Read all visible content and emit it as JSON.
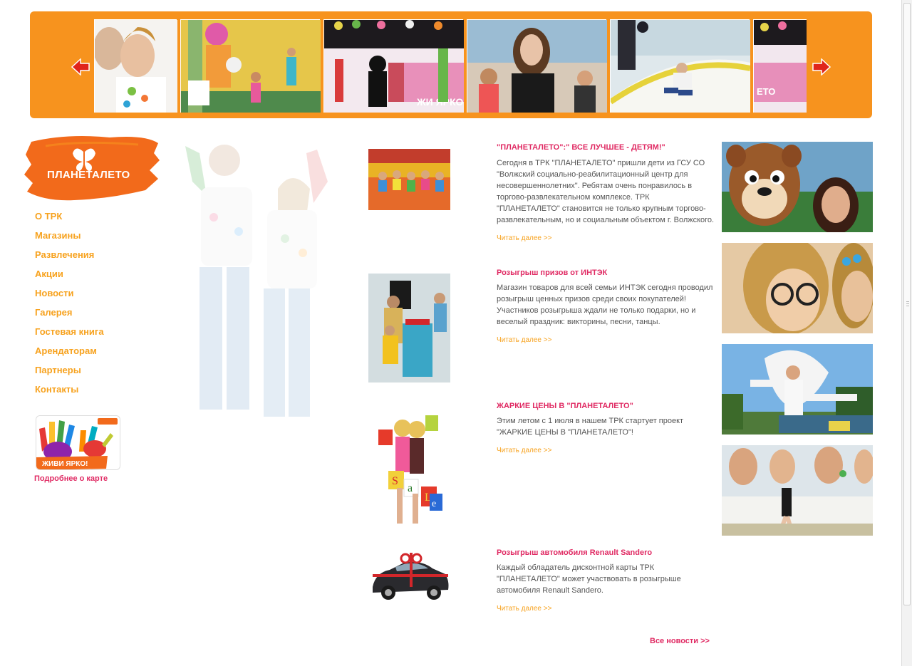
{
  "slider": {
    "prev_label": "",
    "next_label": ""
  },
  "logo": {
    "text": "ПЛАНЕТАЛЕТО"
  },
  "nav": {
    "items": [
      {
        "label": "О ТРК"
      },
      {
        "label": "Магазины"
      },
      {
        "label": "Развлечения"
      },
      {
        "label": "Акции"
      },
      {
        "label": "Новости"
      },
      {
        "label": "Галерея"
      },
      {
        "label": "Гостевая книга"
      },
      {
        "label": "Арендаторам"
      },
      {
        "label": "Партнеры"
      },
      {
        "label": "Контакты"
      }
    ]
  },
  "card": {
    "banner_text": "ЖИВИ ЯРКО!",
    "link": "Подробнее о карте"
  },
  "news": [
    {
      "title": "\"ПЛАНЕТАЛЕТО\":\" ВСЕ ЛУЧШЕЕ - ДЕТЯМ!\"",
      "lines": [
        "Сегодня в ТРК \"ПЛАНЕТАЛЕТО\" пришли дети из ГСУ СО",
        "\"Волжский социально-реабилитационный центр для",
        "несовершеннолетних\". Ребятам очень понравилось в",
        "торгово-развлекательном комплексе. ТРК",
        "\"ПЛАНЕТАЛЕТО\" становится не только крупным торгово-",
        "развлекательным, но и социальным объектом г. Волжского."
      ],
      "more": "Читать далее >>"
    },
    {
      "title": "Розыгрыш призов от ИНТЭК",
      "lines": [
        "Магазин товаров для всей семьи ИНТЭК сегодня проводил",
        "розыгрыш ценных призов среди своих покупателей!",
        "Участников розыгрыша ждали не только подарки, но и",
        "веселый  праздник: викторины, песни, танцы."
      ],
      "more": "Читать далее >>"
    },
    {
      "title": "ЖАРКИЕ ЦЕНЫ В \"ПЛАНЕТАЛЕТО\"",
      "lines": [
        "Этим летом с 1 июля в  нашем ТРК стартует проект",
        "\"ЖАРКИЕ ЦЕНЫ В \"ПЛАНЕТАЛЕТО\"!"
      ],
      "more": "Читать далее >>"
    },
    {
      "title": "Розыгрыш автомобиля Renault Sandero",
      "lines": [
        "Каждый обладатель дисконтной карты ТРК",
        "\"ПЛАНЕТАЛЕТО\" может участвовать в розыгрыше",
        "автомобиля Renault Sandero."
      ],
      "more": "Читать далее >>"
    }
  ],
  "all_news": "Все новости >>",
  "sale_letters": [
    "S",
    "a",
    "L",
    "e"
  ],
  "slide_sign_text": "ЖИ ЯРКО"
}
